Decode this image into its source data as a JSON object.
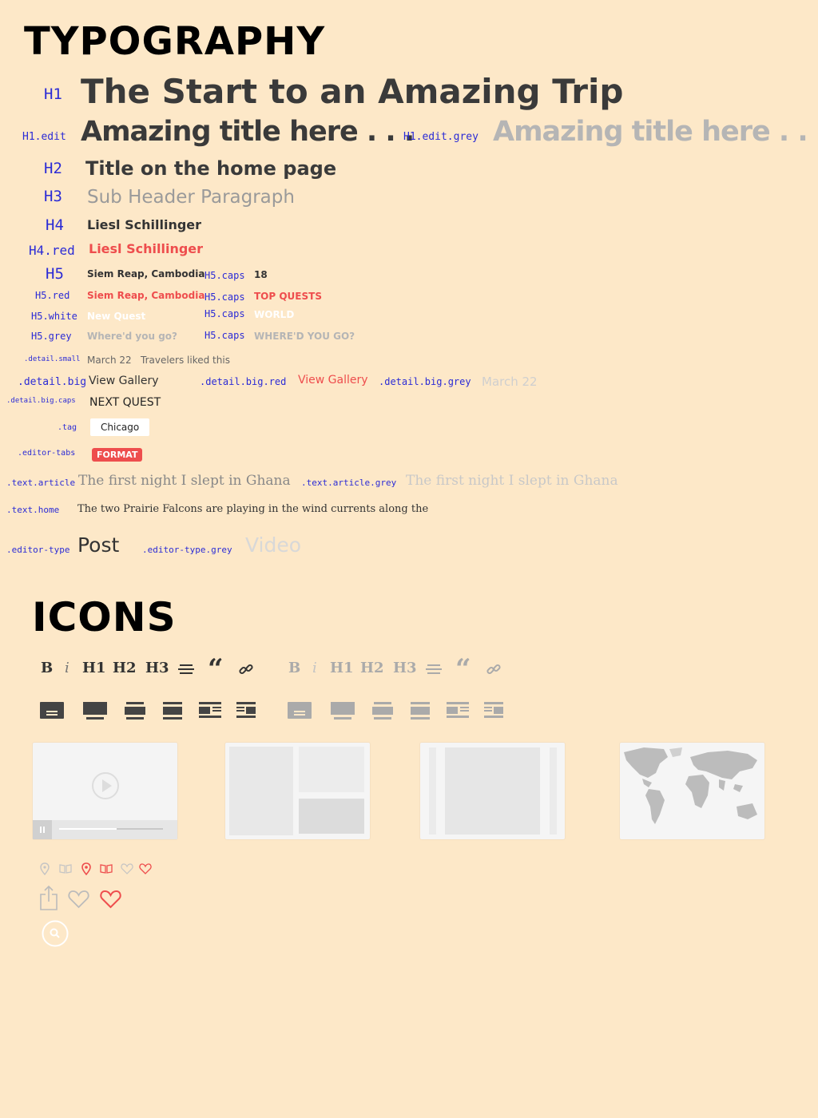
{
  "typography": {
    "heading": "TYPOGRAPHY",
    "h1": {
      "label": "H1",
      "text": "The Start to an Amazing Trip"
    },
    "h1_edit": {
      "label": "H1.edit",
      "text": "Amazing title here . . ."
    },
    "h1_edit_grey": {
      "label": "H1.edit.grey",
      "text": "Amazing title here . . ."
    },
    "h2": {
      "label": "H2",
      "text": "Title on the home page"
    },
    "h3": {
      "label": "H3",
      "text": "Sub Header Paragraph"
    },
    "h4": {
      "label": "H4",
      "text": "Liesl Schillinger"
    },
    "h4_red": {
      "label": "H4.red",
      "text": "Liesl Schillinger"
    },
    "h5": {
      "label": "H5",
      "text": "Siem Reap, Cambodia"
    },
    "h5_caps_1": {
      "label": "H5.caps",
      "text": "18"
    },
    "h5_red": {
      "label": "H5.red",
      "text": "Siem Reap, Cambodia"
    },
    "h5_caps_2": {
      "label": "H5.caps",
      "text": "TOP QUESTS"
    },
    "h5_white": {
      "label": "H5.white",
      "text": "New Quest"
    },
    "h5_caps_3": {
      "label": "H5.caps",
      "text": "WORLD"
    },
    "h5_grey": {
      "label": "H5.grey",
      "text": "Where'd you go?"
    },
    "h5_caps_4": {
      "label": "H5.caps",
      "text": "WHERE'D YOU GO?"
    },
    "detail_small": {
      "label": ".detail.small",
      "text1": "March 22",
      "text2": "Travelers liked this"
    },
    "detail_big": {
      "label": ".detail.big",
      "text": "View Gallery"
    },
    "detail_big_red": {
      "label": ".detail.big.red",
      "text": "View Gallery"
    },
    "detail_big_grey": {
      "label": ".detail.big.grey",
      "text": "March 22"
    },
    "detail_big_caps": {
      "label": ".detail.big.caps",
      "text": "NEXT QUEST"
    },
    "tag": {
      "label": ".tag",
      "text": "Chicago"
    },
    "editor_tabs": {
      "label": ".editor-tabs",
      "text": "FORMAT"
    },
    "text_article": {
      "label": ".text.article",
      "text": "The first night I slept in Ghana"
    },
    "text_article_grey": {
      "label": ".text.article.grey",
      "text": "The first night I slept in Ghana"
    },
    "text_home": {
      "label": ".text.home",
      "text": "The two Prairie Falcons are playing in the wind currents along the"
    },
    "editor_type": {
      "label": ".editor-type",
      "text": "Post"
    },
    "editor_type_grey": {
      "label": ".editor-type.grey",
      "text": "Video"
    }
  },
  "icons": {
    "heading": "ICONS",
    "toolbar": {
      "bold": "B",
      "italic": "i",
      "h1": "H1",
      "h2": "H2",
      "h3": "H3",
      "quote": "“"
    },
    "colors": {
      "dark": "#333333",
      "light": "#aaaaaa",
      "red": "#ee4d4d",
      "bg": "#fde8c8"
    }
  }
}
